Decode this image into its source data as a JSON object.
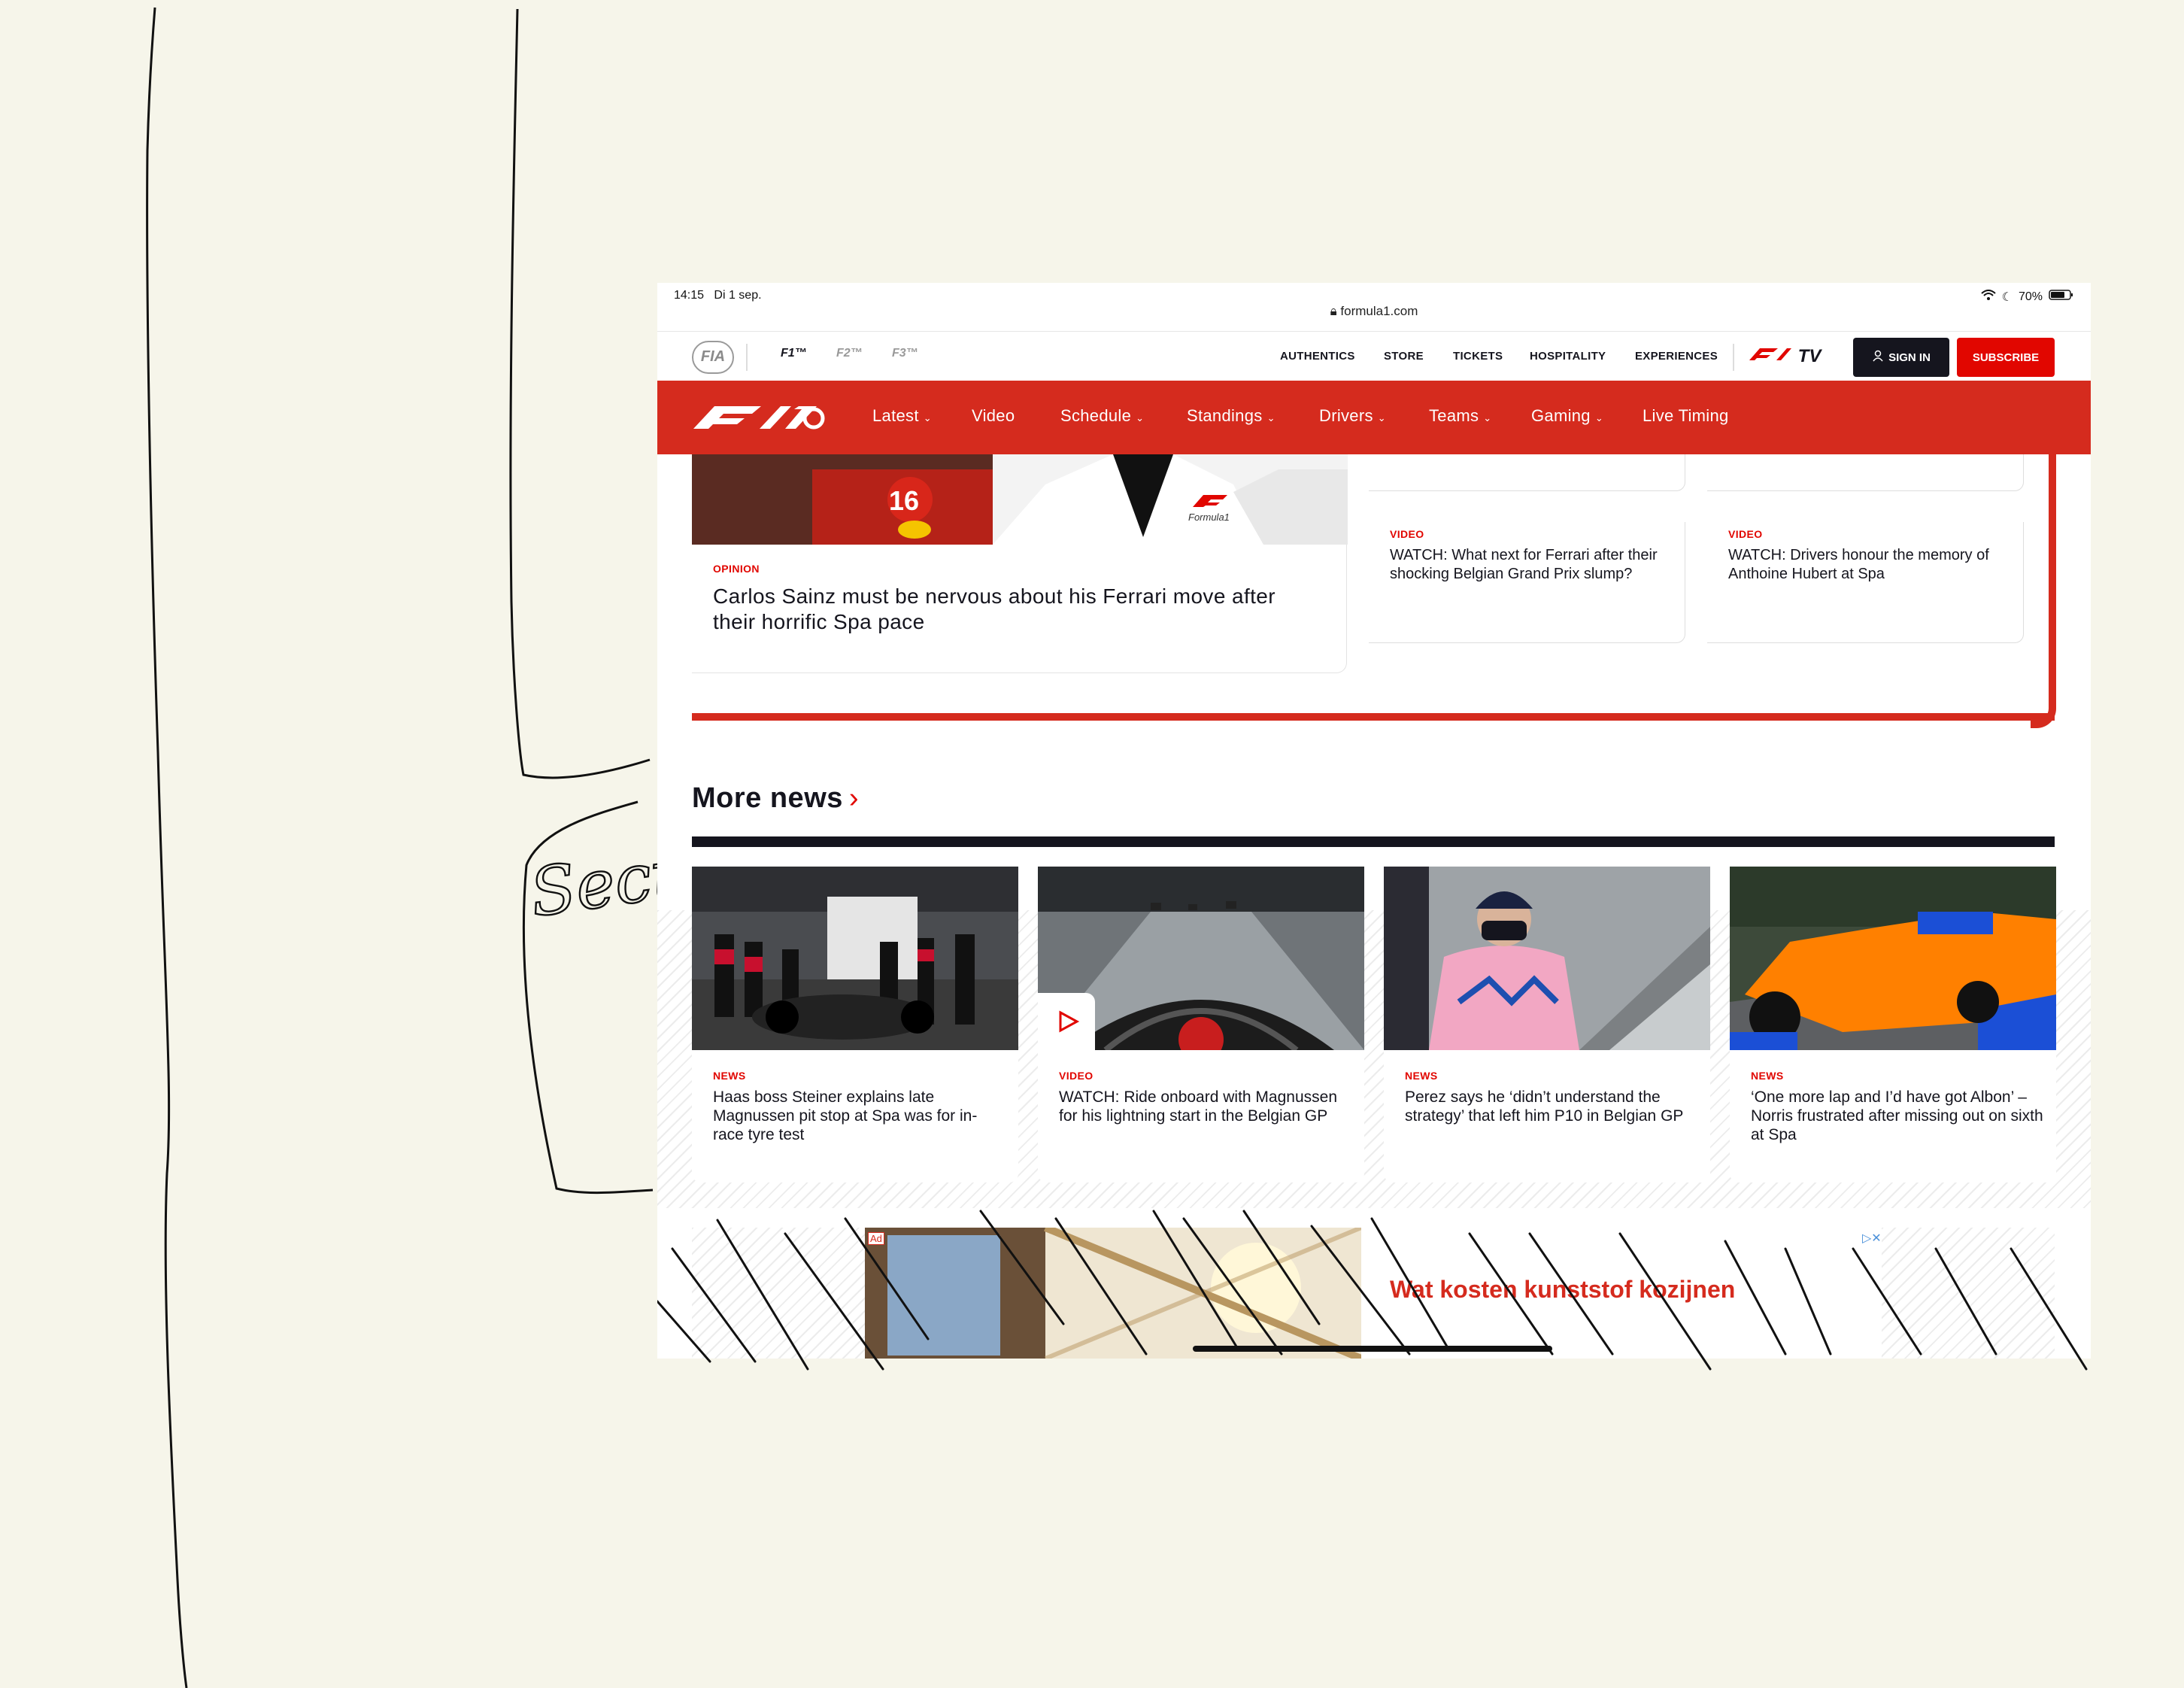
{
  "annotation": {
    "label": "Section"
  },
  "status_bar": {
    "time": "14:15",
    "date": "Di 1 sep.",
    "battery": "70%"
  },
  "browser": {
    "url": "formula1.com"
  },
  "top_nav": {
    "fia": "FIA",
    "series": [
      "F1™",
      "F2™",
      "F3™"
    ],
    "links": [
      "AUTHENTICS",
      "STORE",
      "TICKETS",
      "HOSPITALITY",
      "EXPERIENCES"
    ],
    "tv_label": "TV",
    "sign_in": "SIGN IN",
    "subscribe": "SUBSCRIBE"
  },
  "main_nav": {
    "items": [
      "Latest",
      "Video",
      "Schedule",
      "Standings",
      "Drivers",
      "Teams",
      "Gaming",
      "Live Timing"
    ]
  },
  "featured": {
    "tag": "OPINION",
    "title": "Carlos Sainz must be nervous about his Ferrari move after their horrific Spa pace",
    "hero_text": "Formula1"
  },
  "side_cards": [
    {
      "tag": "VIDEO",
      "title": "WATCH: What next for Ferrari after their shocking Belgian Grand Prix slump?"
    },
    {
      "tag": "VIDEO",
      "title": "WATCH: Drivers honour the memory of Anthoine Hubert at Spa"
    }
  ],
  "more_news": {
    "heading": "More news",
    "chevron": "›",
    "items": [
      {
        "tag": "NEWS",
        "title": "Haas boss Steiner explains late Magnussen pit stop at Spa was for in-race tyre test"
      },
      {
        "tag": "VIDEO",
        "title": "WATCH: Ride onboard with Magnussen for his lightning start in the Belgian GP"
      },
      {
        "tag": "NEWS",
        "title": "Perez says he ‘didn’t understand the strategy’ that left him P10 in Belgian GP"
      },
      {
        "tag": "NEWS",
        "title": "‘One more lap and I’d have got Albon’ – Norris frustrated after missing out on sixth at Spa"
      }
    ]
  },
  "ad": {
    "label": "Ad",
    "text": "Wat kosten kunststof kozijnen",
    "close": "▷✕"
  },
  "colors": {
    "brand_red": "#e10600",
    "dark": "#15151e",
    "paper": "#f6f5ea"
  }
}
